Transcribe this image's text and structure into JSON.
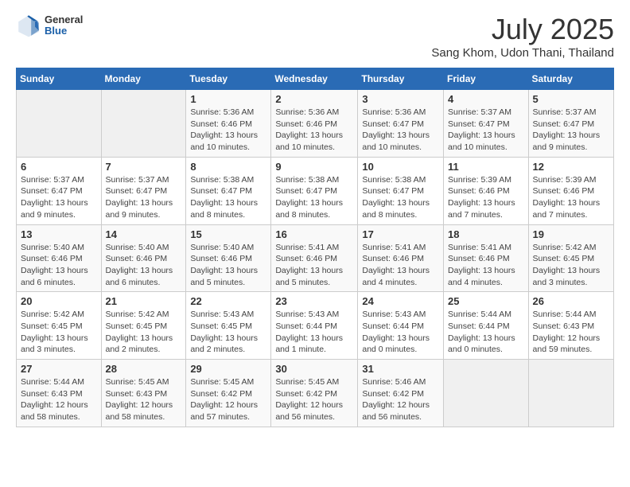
{
  "logo": {
    "general": "General",
    "blue": "Blue"
  },
  "title": "July 2025",
  "subtitle": "Sang Khom, Udon Thani, Thailand",
  "headers": [
    "Sunday",
    "Monday",
    "Tuesday",
    "Wednesday",
    "Thursday",
    "Friday",
    "Saturday"
  ],
  "weeks": [
    [
      {
        "day": "",
        "detail": ""
      },
      {
        "day": "",
        "detail": ""
      },
      {
        "day": "1",
        "detail": "Sunrise: 5:36 AM\nSunset: 6:46 PM\nDaylight: 13 hours and 10 minutes."
      },
      {
        "day": "2",
        "detail": "Sunrise: 5:36 AM\nSunset: 6:46 PM\nDaylight: 13 hours and 10 minutes."
      },
      {
        "day": "3",
        "detail": "Sunrise: 5:36 AM\nSunset: 6:47 PM\nDaylight: 13 hours and 10 minutes."
      },
      {
        "day": "4",
        "detail": "Sunrise: 5:37 AM\nSunset: 6:47 PM\nDaylight: 13 hours and 10 minutes."
      },
      {
        "day": "5",
        "detail": "Sunrise: 5:37 AM\nSunset: 6:47 PM\nDaylight: 13 hours and 9 minutes."
      }
    ],
    [
      {
        "day": "6",
        "detail": "Sunrise: 5:37 AM\nSunset: 6:47 PM\nDaylight: 13 hours and 9 minutes."
      },
      {
        "day": "7",
        "detail": "Sunrise: 5:37 AM\nSunset: 6:47 PM\nDaylight: 13 hours and 9 minutes."
      },
      {
        "day": "8",
        "detail": "Sunrise: 5:38 AM\nSunset: 6:47 PM\nDaylight: 13 hours and 8 minutes."
      },
      {
        "day": "9",
        "detail": "Sunrise: 5:38 AM\nSunset: 6:47 PM\nDaylight: 13 hours and 8 minutes."
      },
      {
        "day": "10",
        "detail": "Sunrise: 5:38 AM\nSunset: 6:47 PM\nDaylight: 13 hours and 8 minutes."
      },
      {
        "day": "11",
        "detail": "Sunrise: 5:39 AM\nSunset: 6:46 PM\nDaylight: 13 hours and 7 minutes."
      },
      {
        "day": "12",
        "detail": "Sunrise: 5:39 AM\nSunset: 6:46 PM\nDaylight: 13 hours and 7 minutes."
      }
    ],
    [
      {
        "day": "13",
        "detail": "Sunrise: 5:40 AM\nSunset: 6:46 PM\nDaylight: 13 hours and 6 minutes."
      },
      {
        "day": "14",
        "detail": "Sunrise: 5:40 AM\nSunset: 6:46 PM\nDaylight: 13 hours and 6 minutes."
      },
      {
        "day": "15",
        "detail": "Sunrise: 5:40 AM\nSunset: 6:46 PM\nDaylight: 13 hours and 5 minutes."
      },
      {
        "day": "16",
        "detail": "Sunrise: 5:41 AM\nSunset: 6:46 PM\nDaylight: 13 hours and 5 minutes."
      },
      {
        "day": "17",
        "detail": "Sunrise: 5:41 AM\nSunset: 6:46 PM\nDaylight: 13 hours and 4 minutes."
      },
      {
        "day": "18",
        "detail": "Sunrise: 5:41 AM\nSunset: 6:46 PM\nDaylight: 13 hours and 4 minutes."
      },
      {
        "day": "19",
        "detail": "Sunrise: 5:42 AM\nSunset: 6:45 PM\nDaylight: 13 hours and 3 minutes."
      }
    ],
    [
      {
        "day": "20",
        "detail": "Sunrise: 5:42 AM\nSunset: 6:45 PM\nDaylight: 13 hours and 3 minutes."
      },
      {
        "day": "21",
        "detail": "Sunrise: 5:42 AM\nSunset: 6:45 PM\nDaylight: 13 hours and 2 minutes."
      },
      {
        "day": "22",
        "detail": "Sunrise: 5:43 AM\nSunset: 6:45 PM\nDaylight: 13 hours and 2 minutes."
      },
      {
        "day": "23",
        "detail": "Sunrise: 5:43 AM\nSunset: 6:44 PM\nDaylight: 13 hours and 1 minute."
      },
      {
        "day": "24",
        "detail": "Sunrise: 5:43 AM\nSunset: 6:44 PM\nDaylight: 13 hours and 0 minutes."
      },
      {
        "day": "25",
        "detail": "Sunrise: 5:44 AM\nSunset: 6:44 PM\nDaylight: 13 hours and 0 minutes."
      },
      {
        "day": "26",
        "detail": "Sunrise: 5:44 AM\nSunset: 6:43 PM\nDaylight: 12 hours and 59 minutes."
      }
    ],
    [
      {
        "day": "27",
        "detail": "Sunrise: 5:44 AM\nSunset: 6:43 PM\nDaylight: 12 hours and 58 minutes."
      },
      {
        "day": "28",
        "detail": "Sunrise: 5:45 AM\nSunset: 6:43 PM\nDaylight: 12 hours and 58 minutes."
      },
      {
        "day": "29",
        "detail": "Sunrise: 5:45 AM\nSunset: 6:42 PM\nDaylight: 12 hours and 57 minutes."
      },
      {
        "day": "30",
        "detail": "Sunrise: 5:45 AM\nSunset: 6:42 PM\nDaylight: 12 hours and 56 minutes."
      },
      {
        "day": "31",
        "detail": "Sunrise: 5:46 AM\nSunset: 6:42 PM\nDaylight: 12 hours and 56 minutes."
      },
      {
        "day": "",
        "detail": ""
      },
      {
        "day": "",
        "detail": ""
      }
    ]
  ]
}
